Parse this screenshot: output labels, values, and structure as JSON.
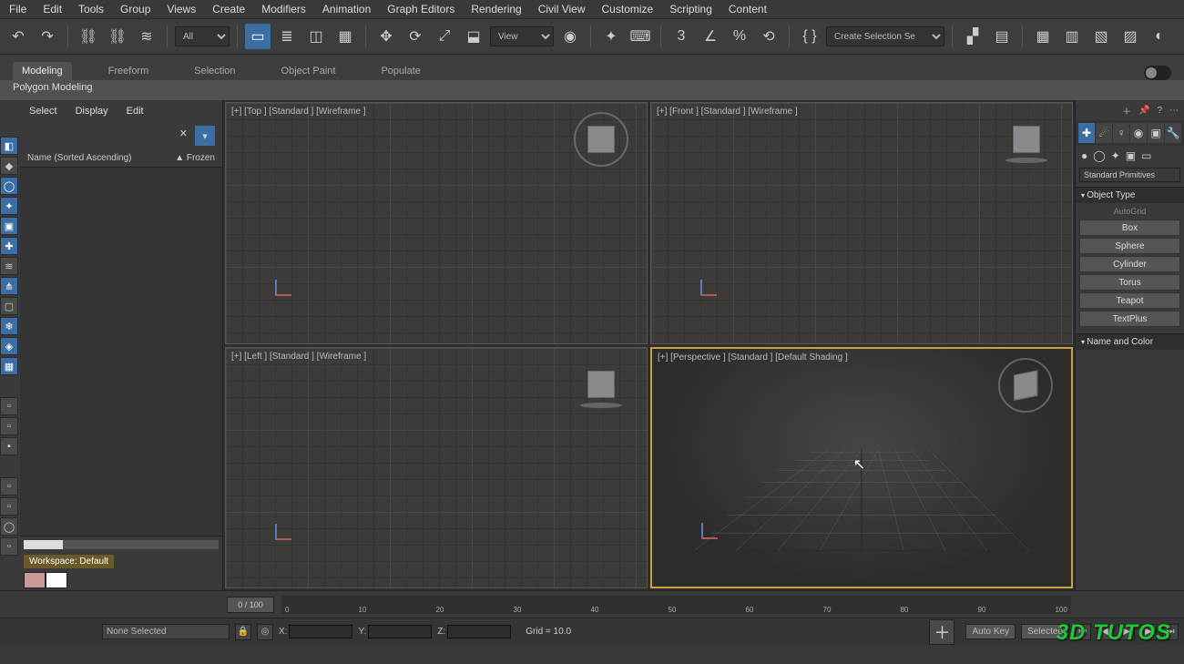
{
  "menu": {
    "items": [
      "File",
      "Edit",
      "Tools",
      "Group",
      "Views",
      "Create",
      "Modifiers",
      "Animation",
      "Graph Editors",
      "Rendering",
      "Civil View",
      "Customize",
      "Scripting",
      "Content"
    ]
  },
  "toolbar": {
    "view_dropdown": "View",
    "selection_set": "Create Selection Se"
  },
  "ribbon": {
    "tabs": [
      "Modeling",
      "Freeform",
      "Selection",
      "Object Paint",
      "Populate"
    ],
    "active": 0,
    "panel": "Polygon Modeling"
  },
  "scene_explorer": {
    "menu": [
      "Select",
      "Display",
      "Edit"
    ],
    "col_name": "Name (Sorted Ascending)",
    "col_frozen": "▲ Frozen",
    "workspace": "Workspace: Default"
  },
  "viewports": {
    "top": "[+] [Top ] [Standard ] [Wireframe ]",
    "front": "[+] [Front ] [Standard ] [Wireframe ]",
    "left": "[+] [Left ] [Standard ] [Wireframe ]",
    "persp": "[+] [Perspective ] [Standard ] [Default Shading ]"
  },
  "command_panel": {
    "dropdown": "Standard Primitives",
    "rollout_object_type": "Object Type",
    "auto_grid": "AutoGrid",
    "buttons": [
      "Box",
      "Sphere",
      "Cylinder",
      "Torus",
      "Teapot",
      "TextPlus"
    ],
    "rollout_name": "Name and Color"
  },
  "time": {
    "slider": "0 / 100",
    "ticks": [
      "0",
      "10",
      "20",
      "30",
      "40",
      "50",
      "60",
      "70",
      "80",
      "90",
      "100"
    ]
  },
  "status": {
    "selection": "None Selected",
    "x_label": "X:",
    "y_label": "Y:",
    "z_label": "Z:",
    "x": "",
    "y": "",
    "z": "",
    "grid": "Grid = 10.0",
    "autokey": "Auto Key",
    "setkey": "Selected"
  },
  "watermark": "3D TUTOS"
}
